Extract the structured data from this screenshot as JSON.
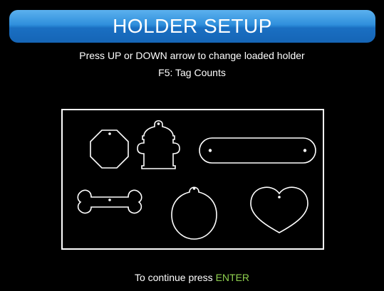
{
  "header": {
    "title": "HOLDER SETUP"
  },
  "instructions": {
    "line1": "Press UP or DOWN arrow to change loaded holder",
    "line2": "F5: Tag Counts"
  },
  "holder": {
    "tags": [
      {
        "shape": "octagon",
        "icon": "octagon-tag-icon"
      },
      {
        "shape": "fire-hydrant",
        "icon": "fire-hydrant-tag-icon"
      },
      {
        "shape": "rounded-bar",
        "icon": "bar-tag-icon"
      },
      {
        "shape": "bone",
        "icon": "bone-tag-icon"
      },
      {
        "shape": "circle",
        "icon": "circle-tag-icon"
      },
      {
        "shape": "heart",
        "icon": "heart-tag-icon"
      }
    ]
  },
  "footer": {
    "prefix": "To continue press ",
    "key": "ENTER"
  },
  "colors": {
    "background": "#000000",
    "title_bar": "#2f8fdc",
    "text": "#ffffff",
    "enter_key": "#8fd14f"
  }
}
